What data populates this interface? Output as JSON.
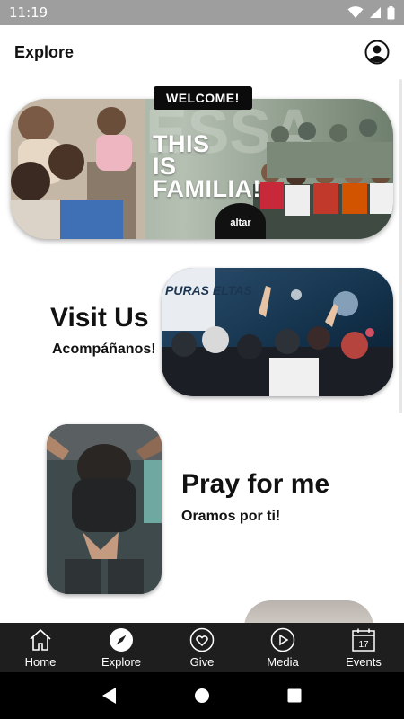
{
  "status_bar": {
    "time": "11:19"
  },
  "header": {
    "title": "Explore"
  },
  "welcome": {
    "badge": "WELCOME!",
    "headline_lines": [
      "THIS",
      "IS",
      "FAMILIA!"
    ],
    "logo_text": "altar"
  },
  "visit": {
    "title": "Visit Us",
    "subtitle": "Acompáñanos!",
    "banner_text": "PURAS ELTAS"
  },
  "pray": {
    "title": "Pray for me",
    "subtitle": "Oramos por ti!"
  },
  "bottom_nav": {
    "items": [
      {
        "label": "Home",
        "icon": "home-icon"
      },
      {
        "label": "Explore",
        "icon": "compass-icon",
        "active": true
      },
      {
        "label": "Give",
        "icon": "heart-icon"
      },
      {
        "label": "Media",
        "icon": "play-icon"
      },
      {
        "label": "Events",
        "icon": "calendar-icon",
        "calendar_day": "17"
      }
    ]
  },
  "system_nav": {
    "buttons": [
      "back",
      "home",
      "recents"
    ]
  },
  "colors": {
    "nav_background": "#1e1e1e",
    "status_bar": "#9e9e9e",
    "text": "#111111"
  }
}
